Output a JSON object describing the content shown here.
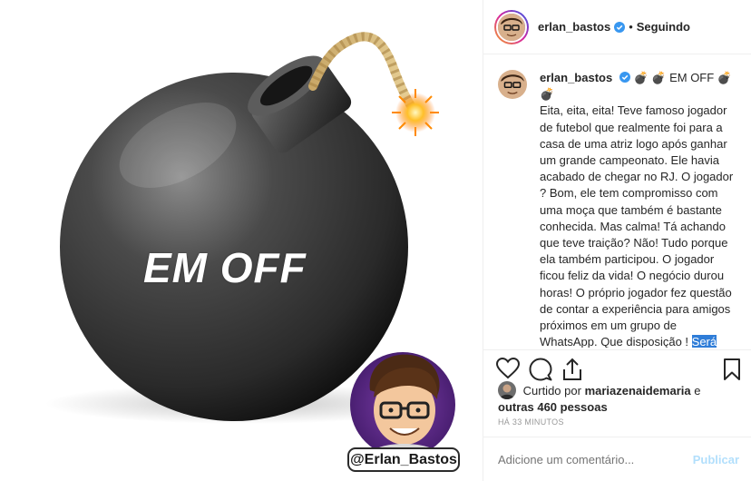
{
  "media": {
    "bomb_label": "EM OFF",
    "watermark_handle": "@Erlan_Bastos"
  },
  "header": {
    "username": "erlan_bastos",
    "separator": "•",
    "follow_status": "Seguindo"
  },
  "caption": {
    "username": "erlan_bastos",
    "title_emojis_left": "💣 💣",
    "title": "EM OFF",
    "title_emojis_right": "💣 💣",
    "body": "Eita, eita, eita! Teve famoso jogador de futebol que realmente foi para a casa de uma atriz logo após ganhar um grande campeonato. Ele havia acabado de chegar no RJ. O jogador ? Bom, ele tem compromisso com uma moça que também é bastante conhecida. Mas calma! Tá achando que teve traição? Não! Tudo porque ela também participou. O jogador ficou feliz da vida! O negócio durou horas! O próprio jogador fez questão de contar a experiência para amigos próximos em um grupo de WhatsApp. Que disposição ! ",
    "highlighted": "Será que esse rolê com duas moças foi um “prêmio” para cada gol?",
    "tail_emojis": " 😱👀"
  },
  "likes": {
    "prefix": "Curtido por",
    "liker": "mariazenaidemaria",
    "connector": "e",
    "others": "outras 460 pessoas"
  },
  "timestamp": "HÁ 33 MINUTOS",
  "comment_box": {
    "placeholder": "Adicione um comentário...",
    "publish_label": "Publicar"
  },
  "colors": {
    "highlight": "#2f7dd8",
    "verified": "#3897f0",
    "publish_disabled": "#b2dffc",
    "avatar_purple": "#5b2a86"
  },
  "icons": [
    "heart-icon",
    "comment-icon",
    "share-icon",
    "bookmark-icon",
    "verified-icon",
    "bomb-icon"
  ]
}
